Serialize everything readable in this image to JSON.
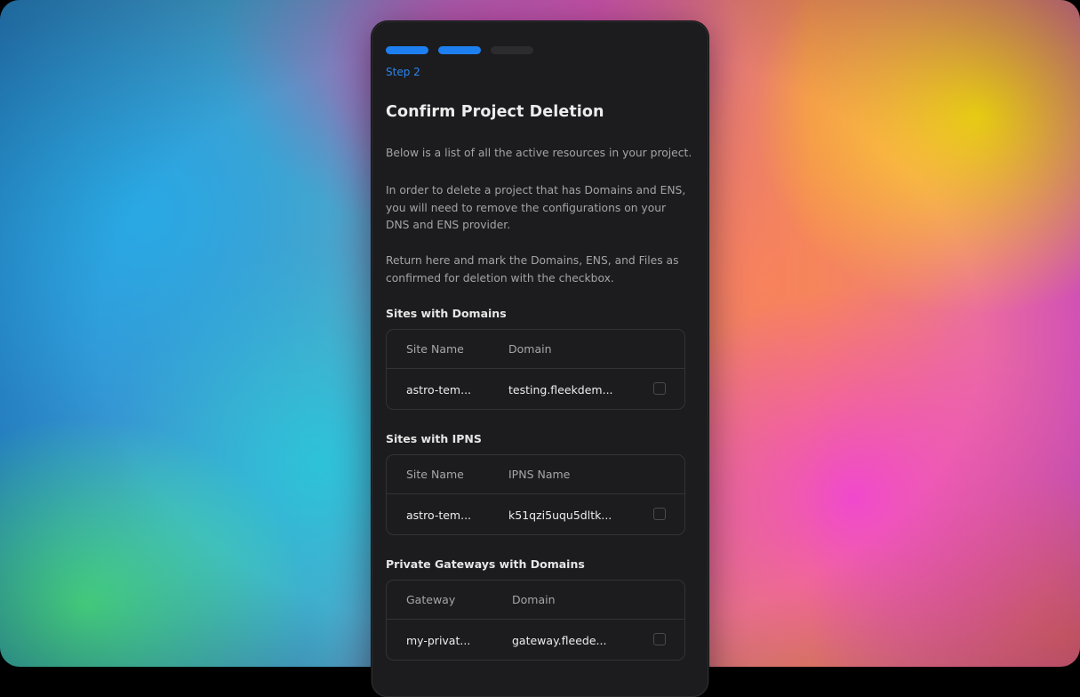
{
  "progress": {
    "total_steps": 3,
    "completed_steps": 2
  },
  "step_label": "Step 2",
  "title": "Confirm Project Deletion",
  "paragraphs": [
    "Below is a list of all the active resources in your project.",
    "In order to delete a project that has Domains and ENS, you will need to remove the configurations on your DNS and ENS provider.",
    "Return here and mark the Domains, ENS, and Files as confirmed for deletion with the checkbox."
  ],
  "sections": [
    {
      "title": "Sites with Domains",
      "columns": [
        "Site Name",
        "Domain"
      ],
      "rows": [
        {
          "name": "astro-tem...",
          "value": "testing.fleekdem...",
          "checked": false
        }
      ]
    },
    {
      "title": "Sites with IPNS",
      "columns": [
        "Site Name",
        "IPNS Name"
      ],
      "rows": [
        {
          "name": "astro-tem...",
          "value": "k51qzi5uqu5dltk...",
          "checked": false
        }
      ]
    },
    {
      "title": "Private Gateways with Domains",
      "columns": [
        "Gateway",
        "Domain"
      ],
      "rows": [
        {
          "name": "my-privat...",
          "value": "gateway.fleede...",
          "checked": false
        }
      ]
    }
  ],
  "colors": {
    "modal_background": "#1c1c1e",
    "accent": "#1e7ff0",
    "progress_inactive": "#2c2c2f",
    "muted_text": "#a4a4a8"
  }
}
